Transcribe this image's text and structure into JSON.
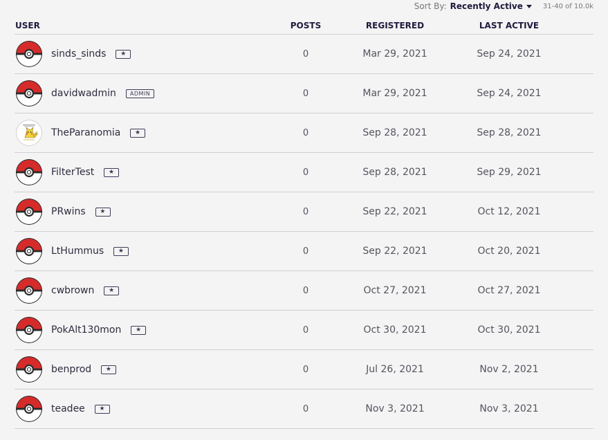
{
  "sort": {
    "label": "Sort By:",
    "value": "Recently Active",
    "range": "31-40 of 10.0k"
  },
  "columns": {
    "user": "USER",
    "posts": "POSTS",
    "registered": "REGISTERED",
    "last_active": "LAST ACTIVE"
  },
  "users": [
    {
      "name": "sinds_sinds",
      "badge": "★",
      "badge_type": "star",
      "avatar": "pokeball-icon",
      "posts": "0",
      "registered": "Mar 29, 2021",
      "last_active": "Sep 24, 2021"
    },
    {
      "name": "davidwadmin",
      "badge": "ADMIN",
      "badge_type": "admin",
      "avatar": "pokeball-icon",
      "posts": "0",
      "registered": "Mar 29, 2021",
      "last_active": "Sep 24, 2021"
    },
    {
      "name": "TheParanomia",
      "badge": "★",
      "badge_type": "star",
      "avatar": "pikachu-icon",
      "posts": "0",
      "registered": "Sep 28, 2021",
      "last_active": "Sep 28, 2021"
    },
    {
      "name": "FilterTest",
      "badge": "★",
      "badge_type": "star",
      "avatar": "pokeball-icon",
      "posts": "0",
      "registered": "Sep 28, 2021",
      "last_active": "Sep 29, 2021"
    },
    {
      "name": "PRwins",
      "badge": "★",
      "badge_type": "star",
      "avatar": "pokeball-icon",
      "posts": "0",
      "registered": "Sep 22, 2021",
      "last_active": "Oct 12, 2021"
    },
    {
      "name": "LtHummus",
      "badge": "★",
      "badge_type": "star",
      "avatar": "pokeball-icon",
      "posts": "0",
      "registered": "Sep 22, 2021",
      "last_active": "Oct 20, 2021"
    },
    {
      "name": "cwbrown",
      "badge": "★",
      "badge_type": "star",
      "avatar": "pokeball-icon",
      "posts": "0",
      "registered": "Oct 27, 2021",
      "last_active": "Oct 27, 2021"
    },
    {
      "name": "PokAlt130mon",
      "badge": "★",
      "badge_type": "star",
      "avatar": "pokeball-icon",
      "posts": "0",
      "registered": "Oct 30, 2021",
      "last_active": "Oct 30, 2021"
    },
    {
      "name": "benprod",
      "badge": "★",
      "badge_type": "star",
      "avatar": "pokeball-icon",
      "posts": "0",
      "registered": "Jul 26, 2021",
      "last_active": "Nov 2, 2021"
    },
    {
      "name": "teadee",
      "badge": "★",
      "badge_type": "star",
      "avatar": "pokeball-icon",
      "posts": "0",
      "registered": "Nov 3, 2021",
      "last_active": "Nov 3, 2021"
    }
  ],
  "colors": {
    "accent": "#1f1a3d",
    "pokeball_red": "#d62b2b",
    "row_border": "#cfcfd6",
    "background": "#f4f4f4"
  }
}
